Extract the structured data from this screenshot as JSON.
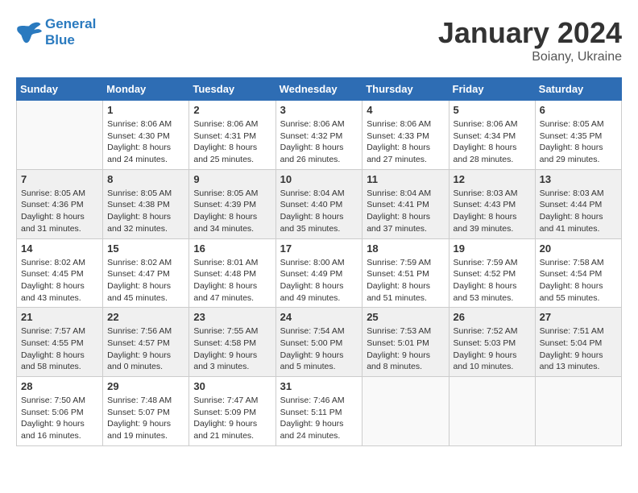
{
  "header": {
    "logo_line1": "General",
    "logo_line2": "Blue",
    "month_year": "January 2024",
    "location": "Boiany, Ukraine"
  },
  "days_of_week": [
    "Sunday",
    "Monday",
    "Tuesday",
    "Wednesday",
    "Thursday",
    "Friday",
    "Saturday"
  ],
  "weeks": [
    [
      {
        "day": "",
        "info": ""
      },
      {
        "day": "1",
        "info": "Sunrise: 8:06 AM\nSunset: 4:30 PM\nDaylight: 8 hours\nand 24 minutes."
      },
      {
        "day": "2",
        "info": "Sunrise: 8:06 AM\nSunset: 4:31 PM\nDaylight: 8 hours\nand 25 minutes."
      },
      {
        "day": "3",
        "info": "Sunrise: 8:06 AM\nSunset: 4:32 PM\nDaylight: 8 hours\nand 26 minutes."
      },
      {
        "day": "4",
        "info": "Sunrise: 8:06 AM\nSunset: 4:33 PM\nDaylight: 8 hours\nand 27 minutes."
      },
      {
        "day": "5",
        "info": "Sunrise: 8:06 AM\nSunset: 4:34 PM\nDaylight: 8 hours\nand 28 minutes."
      },
      {
        "day": "6",
        "info": "Sunrise: 8:05 AM\nSunset: 4:35 PM\nDaylight: 8 hours\nand 29 minutes."
      }
    ],
    [
      {
        "day": "7",
        "info": "Sunrise: 8:05 AM\nSunset: 4:36 PM\nDaylight: 8 hours\nand 31 minutes."
      },
      {
        "day": "8",
        "info": "Sunrise: 8:05 AM\nSunset: 4:38 PM\nDaylight: 8 hours\nand 32 minutes."
      },
      {
        "day": "9",
        "info": "Sunrise: 8:05 AM\nSunset: 4:39 PM\nDaylight: 8 hours\nand 34 minutes."
      },
      {
        "day": "10",
        "info": "Sunrise: 8:04 AM\nSunset: 4:40 PM\nDaylight: 8 hours\nand 35 minutes."
      },
      {
        "day": "11",
        "info": "Sunrise: 8:04 AM\nSunset: 4:41 PM\nDaylight: 8 hours\nand 37 minutes."
      },
      {
        "day": "12",
        "info": "Sunrise: 8:03 AM\nSunset: 4:43 PM\nDaylight: 8 hours\nand 39 minutes."
      },
      {
        "day": "13",
        "info": "Sunrise: 8:03 AM\nSunset: 4:44 PM\nDaylight: 8 hours\nand 41 minutes."
      }
    ],
    [
      {
        "day": "14",
        "info": "Sunrise: 8:02 AM\nSunset: 4:45 PM\nDaylight: 8 hours\nand 43 minutes."
      },
      {
        "day": "15",
        "info": "Sunrise: 8:02 AM\nSunset: 4:47 PM\nDaylight: 8 hours\nand 45 minutes."
      },
      {
        "day": "16",
        "info": "Sunrise: 8:01 AM\nSunset: 4:48 PM\nDaylight: 8 hours\nand 47 minutes."
      },
      {
        "day": "17",
        "info": "Sunrise: 8:00 AM\nSunset: 4:49 PM\nDaylight: 8 hours\nand 49 minutes."
      },
      {
        "day": "18",
        "info": "Sunrise: 7:59 AM\nSunset: 4:51 PM\nDaylight: 8 hours\nand 51 minutes."
      },
      {
        "day": "19",
        "info": "Sunrise: 7:59 AM\nSunset: 4:52 PM\nDaylight: 8 hours\nand 53 minutes."
      },
      {
        "day": "20",
        "info": "Sunrise: 7:58 AM\nSunset: 4:54 PM\nDaylight: 8 hours\nand 55 minutes."
      }
    ],
    [
      {
        "day": "21",
        "info": "Sunrise: 7:57 AM\nSunset: 4:55 PM\nDaylight: 8 hours\nand 58 minutes."
      },
      {
        "day": "22",
        "info": "Sunrise: 7:56 AM\nSunset: 4:57 PM\nDaylight: 9 hours\nand 0 minutes."
      },
      {
        "day": "23",
        "info": "Sunrise: 7:55 AM\nSunset: 4:58 PM\nDaylight: 9 hours\nand 3 minutes."
      },
      {
        "day": "24",
        "info": "Sunrise: 7:54 AM\nSunset: 5:00 PM\nDaylight: 9 hours\nand 5 minutes."
      },
      {
        "day": "25",
        "info": "Sunrise: 7:53 AM\nSunset: 5:01 PM\nDaylight: 9 hours\nand 8 minutes."
      },
      {
        "day": "26",
        "info": "Sunrise: 7:52 AM\nSunset: 5:03 PM\nDaylight: 9 hours\nand 10 minutes."
      },
      {
        "day": "27",
        "info": "Sunrise: 7:51 AM\nSunset: 5:04 PM\nDaylight: 9 hours\nand 13 minutes."
      }
    ],
    [
      {
        "day": "28",
        "info": "Sunrise: 7:50 AM\nSunset: 5:06 PM\nDaylight: 9 hours\nand 16 minutes."
      },
      {
        "day": "29",
        "info": "Sunrise: 7:48 AM\nSunset: 5:07 PM\nDaylight: 9 hours\nand 19 minutes."
      },
      {
        "day": "30",
        "info": "Sunrise: 7:47 AM\nSunset: 5:09 PM\nDaylight: 9 hours\nand 21 minutes."
      },
      {
        "day": "31",
        "info": "Sunrise: 7:46 AM\nSunset: 5:11 PM\nDaylight: 9 hours\nand 24 minutes."
      },
      {
        "day": "",
        "info": ""
      },
      {
        "day": "",
        "info": ""
      },
      {
        "day": "",
        "info": ""
      }
    ]
  ]
}
